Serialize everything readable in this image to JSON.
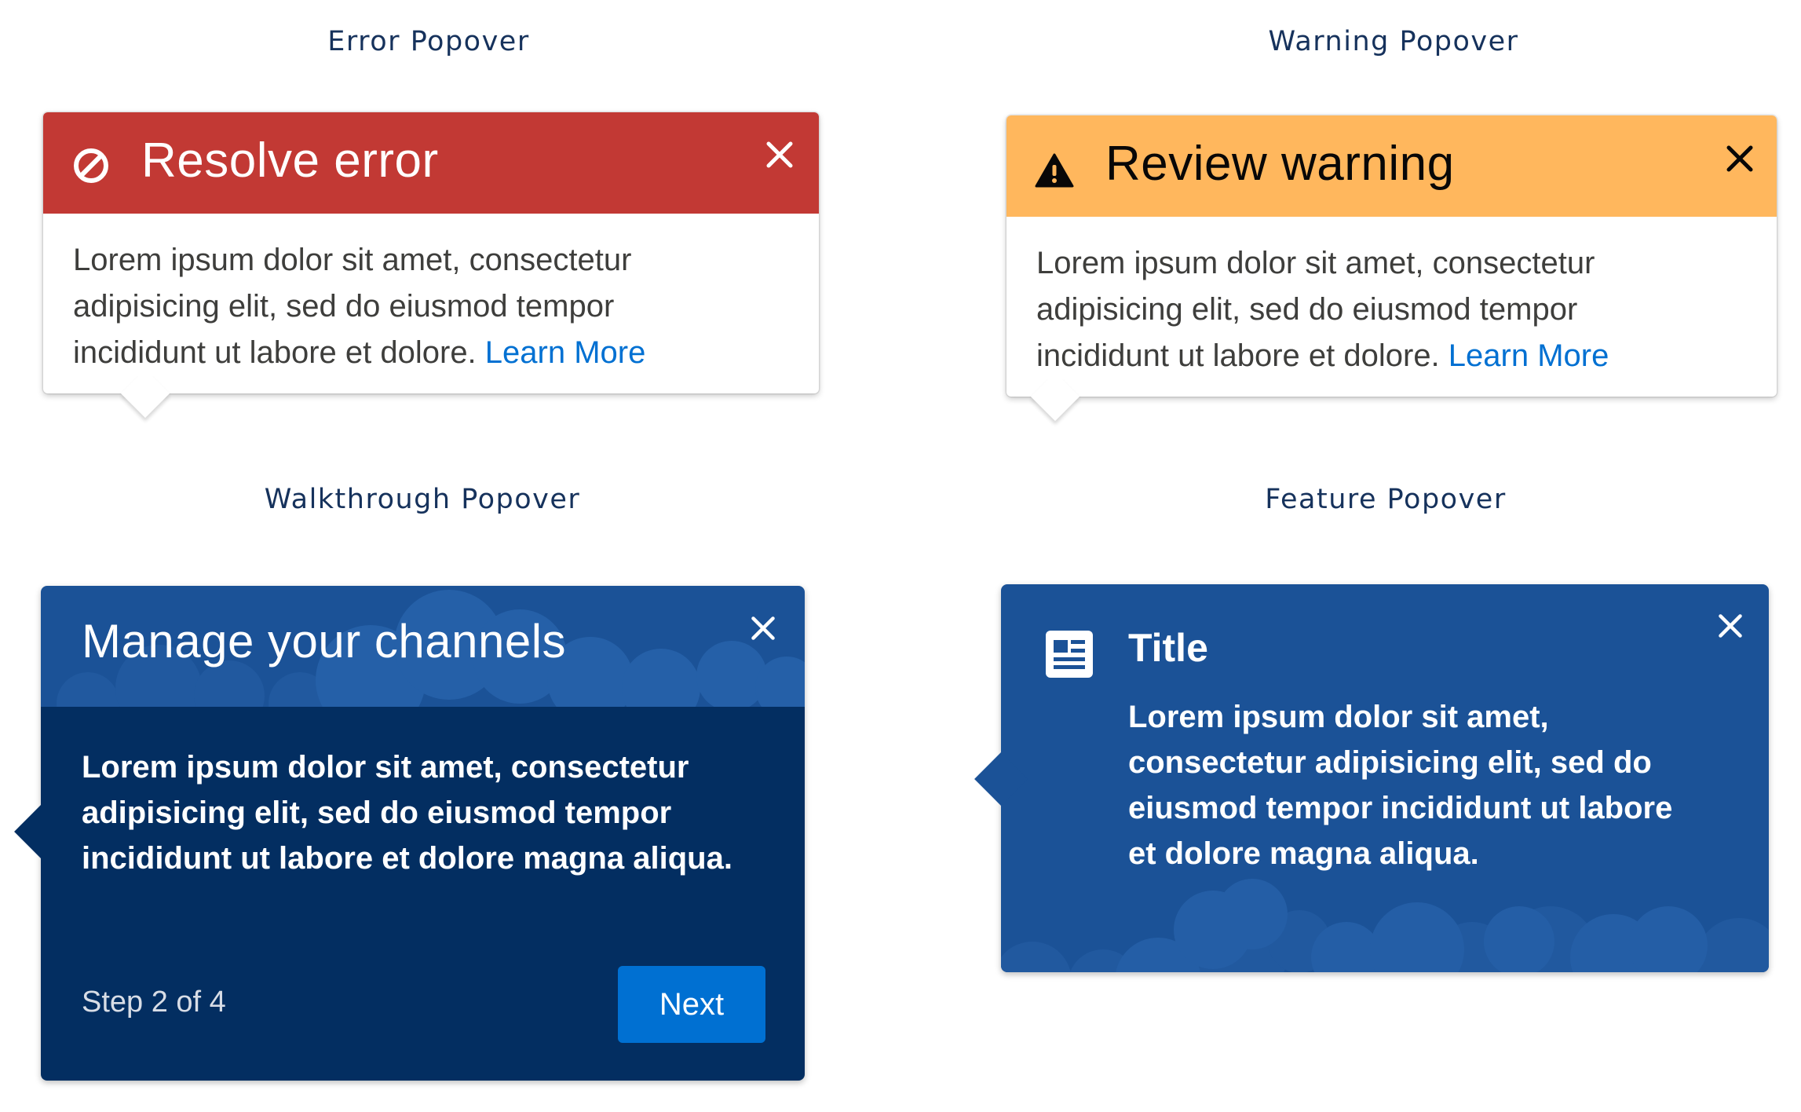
{
  "colors": {
    "error_header": "#c23934",
    "warning_header": "#ffb75d",
    "walkthrough_header": "#1b5297",
    "walkthrough_body": "#032e61",
    "feature_body": "#1b5297",
    "link": "#0070d2",
    "button": "#0070d2"
  },
  "error_popover": {
    "caption": "Error Popover",
    "icon": "ban-icon",
    "title": "Resolve error",
    "body_line1": "Lorem ipsum dolor sit amet, consectetur",
    "body_line2": "adipisicing elit, sed do eiusmod tempor",
    "body_line3": "incididunt ut labore et dolore.",
    "link": "Learn More",
    "close_icon": "close-icon"
  },
  "warning_popover": {
    "caption": "Warning Popover",
    "icon": "warning-icon",
    "title": "Review warning",
    "body_line1": "Lorem ipsum dolor sit amet, consectetur",
    "body_line2": "adipisicing elit, sed do eiusmod tempor",
    "body_line3": "incididunt ut labore et dolore.",
    "link": "Learn More",
    "close_icon": "close-icon"
  },
  "walkthrough_popover": {
    "caption": "Walkthrough Popover",
    "title": "Manage your channels",
    "body_line1": "Lorem ipsum dolor sit amet, consectetur",
    "body_line2": "adipisicing elit, sed do eiusmod tempor",
    "body_line3": "incididunt ut labore et dolore magna aliqua.",
    "step": "Step 2 of 4",
    "next_button": "Next",
    "close_icon": "close-icon"
  },
  "feature_popover": {
    "caption": "Feature Popover",
    "icon": "news-icon",
    "title": "Title",
    "body_line1": "Lorem ipsum dolor sit amet,",
    "body_line2": "consectetur adipisicing elit, sed do",
    "body_line3": "eiusmod tempor incididunt ut labore",
    "body_line4": "et dolore magna aliqua.",
    "close_icon": "close-icon"
  }
}
